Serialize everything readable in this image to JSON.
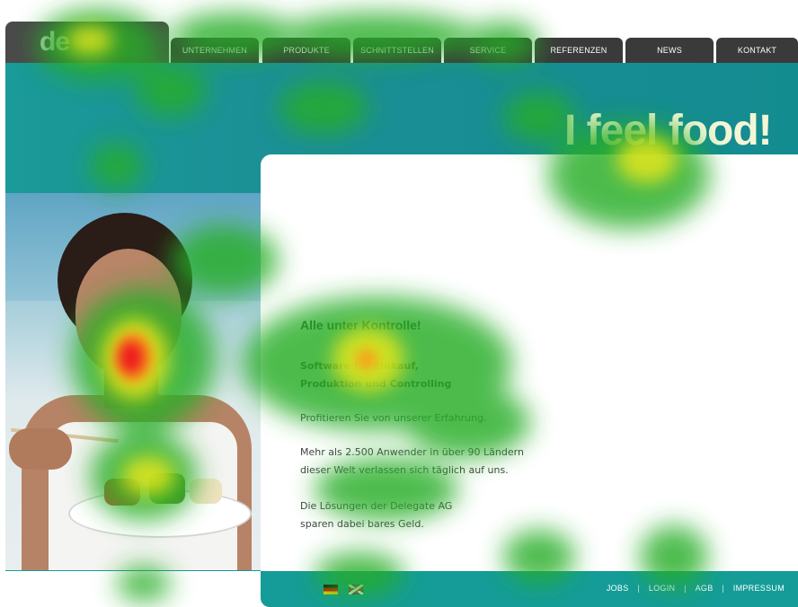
{
  "logo": {
    "text": "de"
  },
  "nav": {
    "tabs": [
      {
        "label": "UNTERNEHMEN"
      },
      {
        "label": "PRODUKTE"
      },
      {
        "label": "SCHNITTSTELLEN"
      },
      {
        "label": "SERVICE"
      },
      {
        "label": "REFERENZEN"
      },
      {
        "label": "NEWS"
      },
      {
        "label": "KONTAKT"
      }
    ]
  },
  "hero": {
    "headline": "I feel food!"
  },
  "content": {
    "title": "Alle unter Kontrolle!",
    "bold_line1": "Software für Einkauf,",
    "bold_line2": "Produktion und Controlling",
    "para1": "Profitieren Sie von unserer Erfahrung.",
    "para2_line1": "Mehr als 2.500 Anwender in über 90 Ländern",
    "para2_line2": "dieser Welt verlassen sich täglich auf uns.",
    "para3_line1": "Die Lösungen der Delegate AG",
    "para3_line2": "sparen dabei bares Geld."
  },
  "footer": {
    "links": [
      "JOBS",
      "LOGIN",
      "AGB",
      "IMPRESSUM"
    ],
    "separator": "|"
  },
  "colors": {
    "teal": "#159c98",
    "nav_dark": "#3a3a3a",
    "heat_hot": "#ff2a1a",
    "heat_warm": "#ffee00",
    "heat_cool": "#2bb02b"
  }
}
